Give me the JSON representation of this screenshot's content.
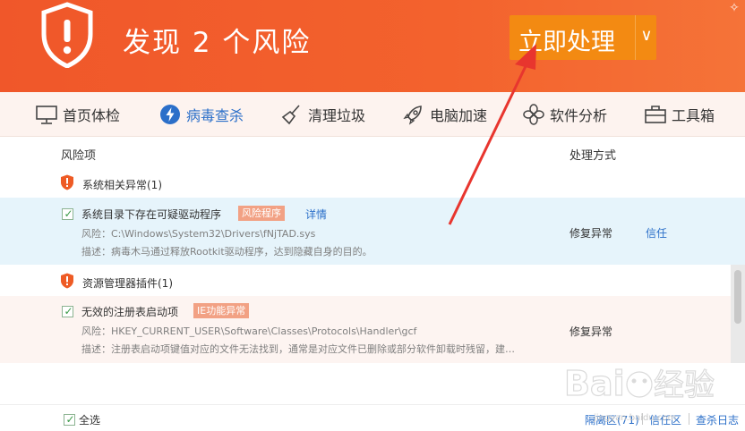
{
  "header": {
    "title": "发现 2 个风险",
    "action_button": "立即处理",
    "corner_icon": "sparkle-icon",
    "colors": {
      "bg": "#f0572a",
      "action": "#f38a12"
    }
  },
  "tabs": [
    {
      "label": "首页体检",
      "icon": "monitor-icon"
    },
    {
      "label": "病毒查杀",
      "icon": "bolt-shield-icon",
      "active": true
    },
    {
      "label": "清理垃圾",
      "icon": "broom-icon"
    },
    {
      "label": "电脑加速",
      "icon": "rocket-icon"
    },
    {
      "label": "软件分析",
      "icon": "pinwheel-icon"
    },
    {
      "label": "工具箱",
      "icon": "toolbox-icon"
    }
  ],
  "list": {
    "col_risk": "风险项",
    "col_method": "处理方式",
    "groups": [
      {
        "title": "系统相关异常(1)",
        "items": [
          {
            "title": "系统目录下存在可疑驱动程序",
            "tag": "风险程序",
            "detail_link": "详情",
            "risk": "风险：C:\\Windows\\System32\\Drivers\\fNjTAD.sys",
            "desc": "描述：病毒木马通过释放Rootkit驱动程序，达到隐藏自身的目的。",
            "method": "修复异常",
            "trust": "信任",
            "checked": true
          }
        ]
      },
      {
        "title": "资源管理器插件(1)",
        "items": [
          {
            "title": "无效的注册表启动项",
            "tag": "IE功能异常",
            "risk": "风险：HKEY_CURRENT_USER\\Software\\Classes\\Protocols\\Handler\\gcf",
            "desc": "描述：注册表启动项键值对应的文件无法找到，通常是对应文件已删除或部分软件卸载时残留，建…",
            "method": "修复异常",
            "checked": true
          }
        ]
      }
    ]
  },
  "bottom": {
    "select_all": "全选",
    "quarantine": "隔离区(71)",
    "trust_zone": "信任区",
    "log": "查杀日志"
  },
  "watermark": {
    "brand": "Baidu经验",
    "url": "jingyan.baidu.com"
  }
}
